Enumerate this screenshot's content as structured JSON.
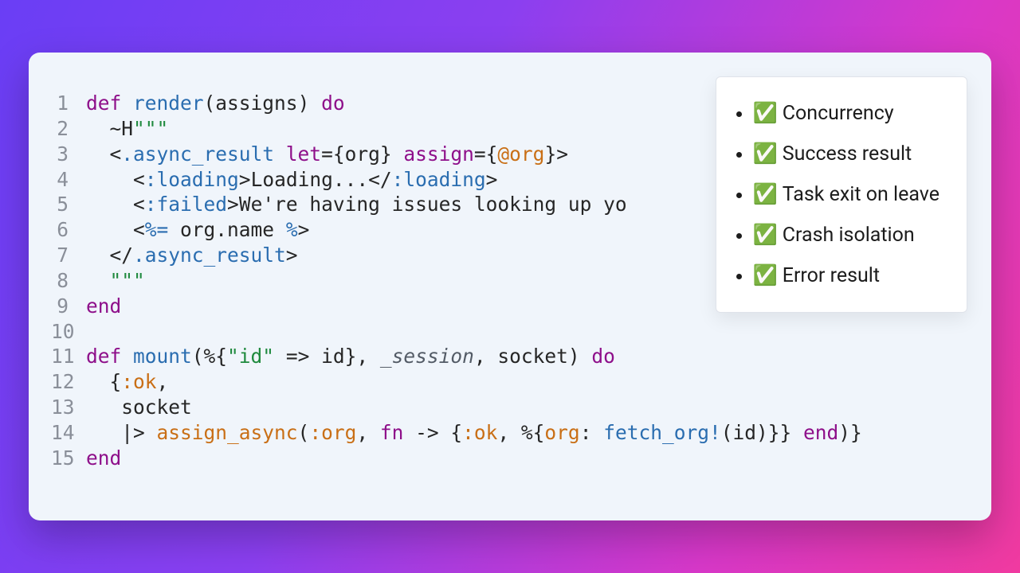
{
  "checklist": {
    "items": [
      {
        "label": "Concurrency"
      },
      {
        "label": "Success result"
      },
      {
        "label": "Task exit on leave"
      },
      {
        "label": "Crash isolation"
      },
      {
        "label": "Error result"
      }
    ],
    "check_glyph": "✅"
  },
  "code": {
    "lines": [
      {
        "n": 1,
        "tokens": [
          [
            "kw",
            "def "
          ],
          [
            "fn",
            "render"
          ],
          [
            "brkt",
            "("
          ],
          [
            "var",
            "assigns"
          ],
          [
            "brkt",
            ") "
          ],
          [
            "kw",
            "do"
          ]
        ]
      },
      {
        "n": 2,
        "tokens": [
          [
            "var",
            "  ~H"
          ],
          [
            "str",
            "\"\"\""
          ]
        ]
      },
      {
        "n": 3,
        "tokens": [
          [
            "var",
            "  "
          ],
          [
            "brkt",
            "<"
          ],
          [
            "tag",
            ".async_result "
          ],
          [
            "attr",
            "let"
          ],
          [
            "op",
            "="
          ],
          [
            "brkt",
            "{"
          ],
          [
            "var",
            "org"
          ],
          [
            "brkt",
            "} "
          ],
          [
            "attr",
            "assign"
          ],
          [
            "op",
            "="
          ],
          [
            "brkt",
            "{"
          ],
          [
            "id",
            "@org"
          ],
          [
            "brkt",
            "}>"
          ]
        ]
      },
      {
        "n": 4,
        "tokens": [
          [
            "var",
            "    "
          ],
          [
            "brkt",
            "<"
          ],
          [
            "tag",
            ":loading"
          ],
          [
            "brkt",
            ">"
          ],
          [
            "var",
            "Loading..."
          ],
          [
            "brkt",
            "</"
          ],
          [
            "tag",
            ":loading"
          ],
          [
            "brkt",
            ">"
          ]
        ]
      },
      {
        "n": 5,
        "tokens": [
          [
            "var",
            "    "
          ],
          [
            "brkt",
            "<"
          ],
          [
            "tag",
            ":failed"
          ],
          [
            "brkt",
            ">"
          ],
          [
            "var",
            "We're having issues looking up yo"
          ]
        ]
      },
      {
        "n": 6,
        "tokens": [
          [
            "var",
            "    "
          ],
          [
            "brkt",
            "<"
          ],
          [
            "tag",
            "%= "
          ],
          [
            "var",
            "org.name "
          ],
          [
            "tag",
            "%"
          ],
          [
            "brkt",
            ">"
          ]
        ]
      },
      {
        "n": 7,
        "tokens": [
          [
            "var",
            "  "
          ],
          [
            "brkt",
            "</"
          ],
          [
            "tag",
            ".async_result"
          ],
          [
            "brkt",
            ">"
          ]
        ]
      },
      {
        "n": 8,
        "tokens": [
          [
            "var",
            "  "
          ],
          [
            "str",
            "\"\"\""
          ]
        ]
      },
      {
        "n": 9,
        "tokens": [
          [
            "kw",
            "end"
          ]
        ]
      },
      {
        "n": 10,
        "tokens": [
          [
            "var",
            ""
          ]
        ]
      },
      {
        "n": 11,
        "tokens": [
          [
            "kw",
            "def "
          ],
          [
            "fn",
            "mount"
          ],
          [
            "brkt",
            "(%{"
          ],
          [
            "str",
            "\"id\""
          ],
          [
            "op",
            " => "
          ],
          [
            "var",
            "id"
          ],
          [
            "brkt",
            "}, "
          ],
          [
            "param",
            "_session"
          ],
          [
            "brkt",
            ", "
          ],
          [
            "var",
            "socket"
          ],
          [
            "brkt",
            ") "
          ],
          [
            "kw",
            "do"
          ]
        ]
      },
      {
        "n": 12,
        "tokens": [
          [
            "var",
            "  "
          ],
          [
            "brkt",
            "{"
          ],
          [
            "atom",
            ":ok"
          ],
          [
            "brkt",
            ","
          ]
        ]
      },
      {
        "n": 13,
        "tokens": [
          [
            "var",
            "   socket"
          ]
        ]
      },
      {
        "n": 14,
        "tokens": [
          [
            "var",
            "   "
          ],
          [
            "pipe",
            "|> "
          ],
          [
            "assign-async",
            "assign_async"
          ],
          [
            "brkt",
            "("
          ],
          [
            "atom",
            ":org"
          ],
          [
            "brkt",
            ", "
          ],
          [
            "kw",
            "fn"
          ],
          [
            "op",
            " -> "
          ],
          [
            "brkt",
            "{"
          ],
          [
            "atom",
            ":ok"
          ],
          [
            "brkt",
            ", %{"
          ],
          [
            "atom",
            "org"
          ],
          [
            "brkt",
            ": "
          ],
          [
            "call",
            "fetch_org!"
          ],
          [
            "brkt",
            "("
          ],
          [
            "var",
            "id"
          ],
          [
            "brkt",
            ")}} "
          ],
          [
            "kw",
            "end"
          ],
          [
            "brkt",
            ")}"
          ]
        ]
      },
      {
        "n": 15,
        "tokens": [
          [
            "kw",
            "end"
          ]
        ]
      }
    ]
  }
}
